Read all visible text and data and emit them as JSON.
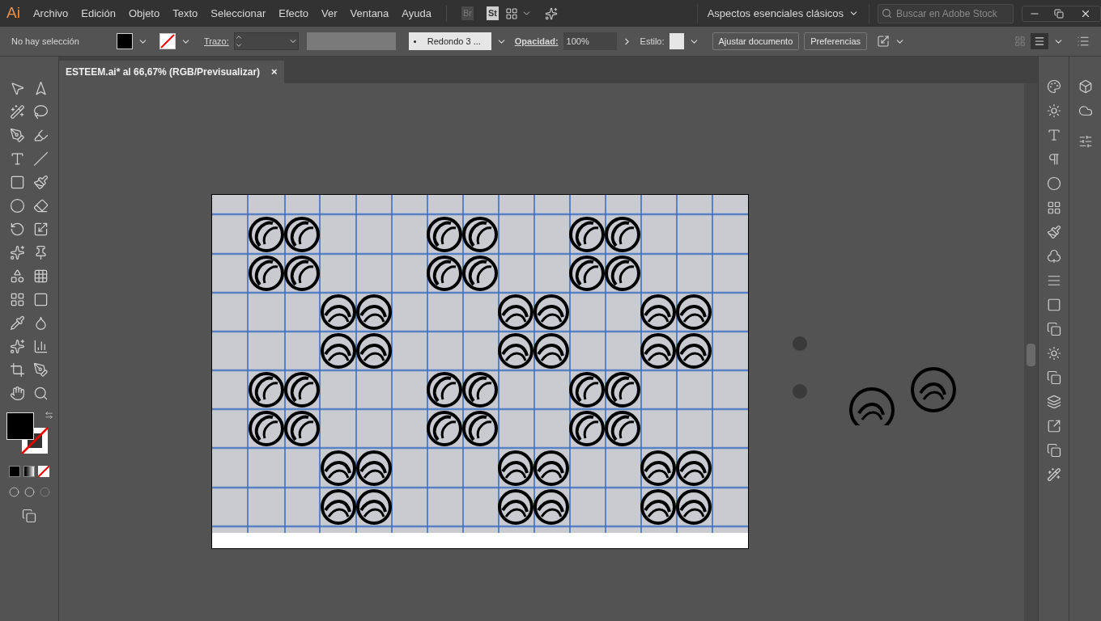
{
  "app": {
    "logo": "Ai"
  },
  "menu": [
    "Archivo",
    "Edición",
    "Objeto",
    "Texto",
    "Seleccionar",
    "Efecto",
    "Ver",
    "Ventana",
    "Ayuda"
  ],
  "app_bar": {
    "bridge": "Br",
    "stock": "St",
    "workspace": "Aspectos esenciales clásicos",
    "search": {
      "placeholder": "Buscar en Adobe Stock"
    }
  },
  "control_bar": {
    "selection": "No hay selección",
    "stroke_label": "Trazo:",
    "brush": "Redondo 3 ...",
    "opacity_label": "Opacidad:",
    "opacity": "100%",
    "style_label": "Estilo:",
    "buttons": [
      "Ajustar documento",
      "Preferencias"
    ]
  },
  "document_tab": {
    "title": "ESTEEM.ai* al 66,67% (RGB/Previsualizar)",
    "close": "×"
  }
}
